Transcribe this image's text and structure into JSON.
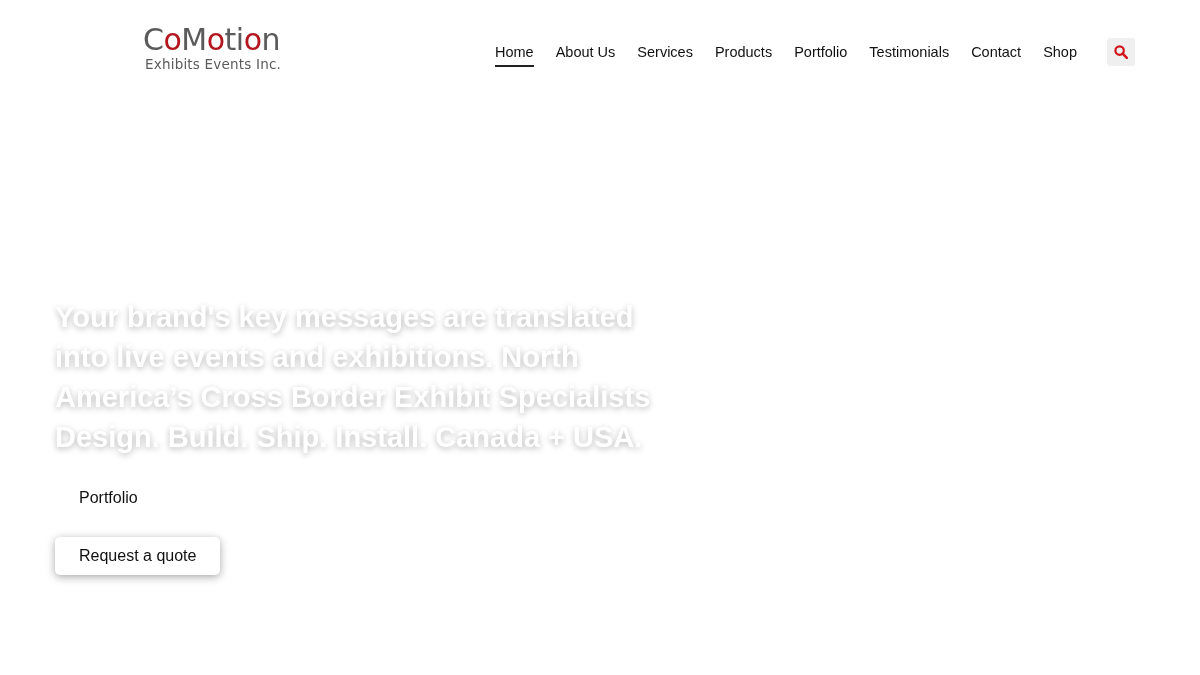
{
  "header": {
    "logo": {
      "wordmark": [
        {
          "text": "C",
          "accent": false
        },
        {
          "text": "o",
          "accent": true
        },
        {
          "text": "M",
          "accent": false
        },
        {
          "text": "o",
          "accent": true
        },
        {
          "text": "ti",
          "accent": false
        },
        {
          "text": "o",
          "accent": true
        },
        {
          "text": "n",
          "accent": false
        }
      ],
      "tagline": "Exhibits Events Inc."
    },
    "nav": [
      {
        "label": "Home",
        "selected": true
      },
      {
        "label": "About Us",
        "selected": false
      },
      {
        "label": "Services",
        "selected": false
      },
      {
        "label": "Products",
        "selected": false
      },
      {
        "label": "Portfolio",
        "selected": false
      },
      {
        "label": "Testimonials",
        "selected": false
      },
      {
        "label": "Contact",
        "selected": false
      },
      {
        "label": "Shop",
        "selected": false
      }
    ]
  },
  "hero": {
    "headline": "Your brand's key messages are translated into live events and exhibitions. North America’s Cross Border Exhibit Specialists Design. Build. Ship. Install. Canada + USA.",
    "buttons": [
      {
        "label": "Portfolio",
        "kind": "plain"
      },
      {
        "label": "Request a quote",
        "kind": "raised"
      }
    ]
  }
}
